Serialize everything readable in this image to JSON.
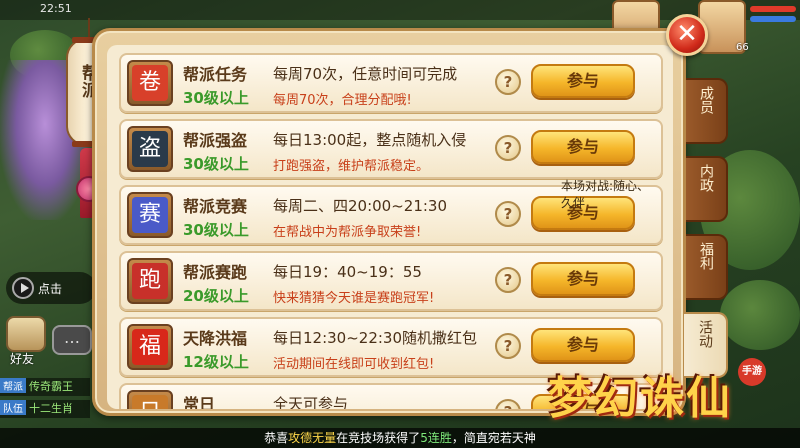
{
  "status": {
    "time": "22:51"
  },
  "scene": {
    "play_hint": "点击",
    "friend_label": "好友",
    "chat_lines": [
      {
        "tag": "帮派",
        "text": "传奇霸王"
      },
      {
        "tag": "队伍",
        "text": "十二生肖"
      }
    ],
    "player_level": "66"
  },
  "panel": {
    "lantern_title": "帮派",
    "rows": [
      {
        "name": "帮派任务",
        "level": "30级以上",
        "time": "每周70次，任意时间可完成",
        "desc": "每周70次，合理分配哦!",
        "join": "参与",
        "icon": "task-scroll-icon",
        "glyph": "卷",
        "icon_color": "#d8402a"
      },
      {
        "name": "帮派强盗",
        "level": "30级以上",
        "time": "每日13:00起，整点随机入侵",
        "desc": "打跑强盗，维护帮派稳定。",
        "join": "参与",
        "icon": "bandit-flag-icon",
        "glyph": "盗",
        "icon_color": "#2a3a4a"
      },
      {
        "name": "帮派竞赛",
        "level": "30级以上",
        "time": "每周二、四20:00~21:30",
        "desc": "在帮战中为帮派争取荣誉!",
        "join": "参与",
        "icon": "competition-arena-icon",
        "glyph": "赛",
        "icon_color": "#4a5ac8",
        "note": "本场对战:随心、久伴"
      },
      {
        "name": "帮派赛跑",
        "level": "20级以上",
        "time": "每日19：40~19：55",
        "desc": "快来猜猜今天谁是赛跑冠军!",
        "join": "参与",
        "icon": "race-treasure-icon",
        "glyph": "跑",
        "icon_color": "#c8302a"
      },
      {
        "name": "天降洪福",
        "level": "12级以上",
        "time": "每日12:30~22:30随机撒红包",
        "desc": "活动期间在线即可收到红包!",
        "join": "参与",
        "icon": "red-envelope-icon",
        "glyph": "福",
        "icon_color": "#d8281a"
      },
      {
        "name": "常日",
        "level": "",
        "time": "全天可参与",
        "desc": "",
        "join": "参与",
        "icon": "daily-icon",
        "glyph": "日",
        "icon_color": "#c87a2a"
      }
    ],
    "help_symbol": "?",
    "close_symbol": "✕"
  },
  "tabs": [
    {
      "label": "成员"
    },
    {
      "label": "内政"
    },
    {
      "label": "福利"
    },
    {
      "label": "活动"
    }
  ],
  "banner": {
    "prefix": "恭喜",
    "player": "攻德无量",
    "middle": "在竞技场获得了",
    "streak": "5连胜",
    "suffix": "，简直宛若天神"
  },
  "logo": {
    "title": "梦幻诛仙",
    "badge": "手游"
  }
}
